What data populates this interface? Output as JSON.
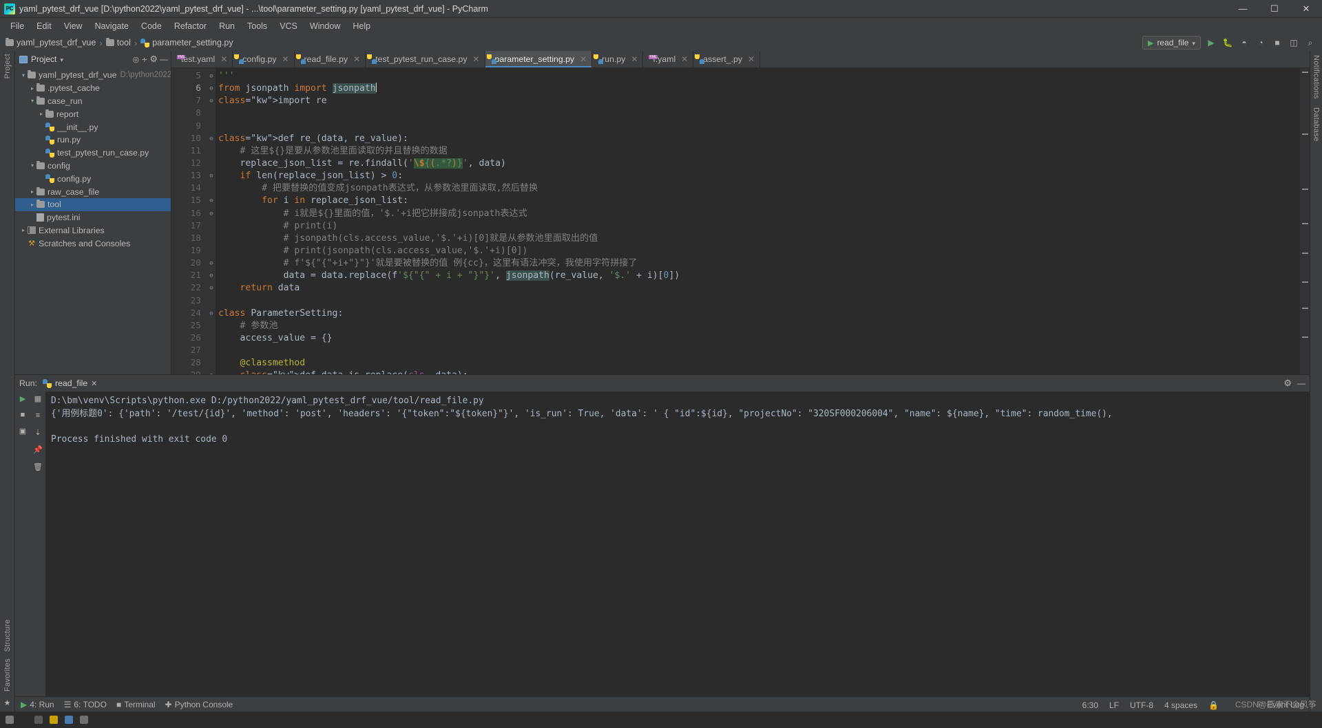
{
  "window": {
    "title": "yaml_pytest_drf_vue [D:\\python2022\\yaml_pytest_drf_vue] - ...\\tool\\parameter_setting.py [yaml_pytest_drf_vue] - PyCharm",
    "logo_text": "PC",
    "minimize": "—",
    "maximize": "☐",
    "close": "✕"
  },
  "menubar": {
    "items": [
      "File",
      "Edit",
      "View",
      "Navigate",
      "Code",
      "Refactor",
      "Run",
      "Tools",
      "VCS",
      "Window",
      "Help"
    ]
  },
  "breadcrumb": {
    "items": [
      {
        "label": "yaml_pytest_drf_vue",
        "icon": "folder-icon"
      },
      {
        "label": "tool",
        "icon": "folder-icon"
      },
      {
        "label": "parameter_setting.py",
        "icon": "python-file-icon"
      }
    ]
  },
  "navbar_right": {
    "run_config": "read_file",
    "run_config_chevron": "▾",
    "run_button": "▶",
    "debug_button": "🐞",
    "coverage_button": "◴",
    "profile_button": "◔",
    "stop_button": "■",
    "search_button": "⌕"
  },
  "left_stripe": {
    "labels": [
      "Project"
    ],
    "bottom_labels": [
      "Favorites"
    ],
    "structure_label": "Structure"
  },
  "right_stripe": {
    "labels": [
      "Notifications",
      "Database"
    ]
  },
  "project_panel": {
    "title": "Project",
    "title_chevron": "▾",
    "actions": [
      "target-icon",
      "collapse-all-icon",
      "settings-icon",
      "hide-icon"
    ],
    "tree": [
      {
        "depth": 0,
        "arrow": "▾",
        "icon": "folder-icon",
        "label": "yaml_pytest_drf_vue",
        "path": "D:\\python2022\\",
        "selected": false
      },
      {
        "depth": 1,
        "arrow": "▸",
        "icon": "folder-icon",
        "label": ".pytest_cache",
        "path": "",
        "selected": false
      },
      {
        "depth": 1,
        "arrow": "▾",
        "icon": "folder-icon",
        "label": "case_run",
        "path": "",
        "selected": false
      },
      {
        "depth": 2,
        "arrow": "▸",
        "icon": "folder-icon",
        "label": "report",
        "path": "",
        "selected": false
      },
      {
        "depth": 2,
        "arrow": "",
        "icon": "python-file-icon",
        "label": "__init__.py",
        "path": "",
        "selected": false
      },
      {
        "depth": 2,
        "arrow": "",
        "icon": "python-file-icon",
        "label": "run.py",
        "path": "",
        "selected": false
      },
      {
        "depth": 2,
        "arrow": "",
        "icon": "python-file-icon",
        "label": "test_pytest_run_case.py",
        "path": "",
        "selected": false
      },
      {
        "depth": 1,
        "arrow": "▾",
        "icon": "folder-icon",
        "label": "config",
        "path": "",
        "selected": false
      },
      {
        "depth": 2,
        "arrow": "",
        "icon": "python-file-icon",
        "label": "config.py",
        "path": "",
        "selected": false
      },
      {
        "depth": 1,
        "arrow": "▸",
        "icon": "folder-icon",
        "label": "raw_case_file",
        "path": "",
        "selected": false
      },
      {
        "depth": 1,
        "arrow": "▸",
        "icon": "folder-icon",
        "label": "tool",
        "path": "",
        "selected": true
      },
      {
        "depth": 1,
        "arrow": "",
        "icon": "ini-file-icon",
        "label": "pytest.ini",
        "path": "",
        "selected": false
      },
      {
        "depth": 0,
        "arrow": "▸",
        "icon": "library-icon",
        "label": "External Libraries",
        "path": "",
        "selected": false
      },
      {
        "depth": 0,
        "arrow": "",
        "icon": "scratches-icon",
        "label": "Scratches and Consoles",
        "path": "",
        "selected": false
      }
    ]
  },
  "editor_tabs": [
    {
      "label": "test.yaml",
      "icon": "yaml-file-icon",
      "active": false
    },
    {
      "label": "config.py",
      "icon": "python-file-icon",
      "active": false
    },
    {
      "label": "read_file.py",
      "icon": "python-file-icon",
      "active": false
    },
    {
      "label": "test_pytest_run_case.py",
      "icon": "python-file-icon",
      "active": false
    },
    {
      "label": "parameter_setting.py",
      "icon": "python-file-icon",
      "active": true
    },
    {
      "label": "run.py",
      "icon": "python-file-icon",
      "active": false
    },
    {
      "label": "f.yaml",
      "icon": "yaml-file-icon",
      "active": false
    },
    {
      "label": "assert_.py",
      "icon": "python-file-icon",
      "active": false
    }
  ],
  "editor": {
    "first_line": 5,
    "current_line": 6,
    "lines": [
      {
        "n": 5,
        "fold": "⊖",
        "text": "'''"
      },
      {
        "n": 6,
        "fold": "⊖",
        "text": "from jsonpath import jsonpath"
      },
      {
        "n": 7,
        "fold": "⊖",
        "text": "import re"
      },
      {
        "n": 8,
        "fold": "",
        "text": ""
      },
      {
        "n": 9,
        "fold": "",
        "text": ""
      },
      {
        "n": 10,
        "fold": "⊖",
        "text": "def re_(data, re_value):"
      },
      {
        "n": 11,
        "fold": "",
        "text": "    # 这里${}是要从参数池里面读取的并且替换的数据"
      },
      {
        "n": 12,
        "fold": "",
        "text": "    replace_json_list = re.findall('\\${(.*?)}', data)"
      },
      {
        "n": 13,
        "fold": "⊖",
        "text": "    if len(replace_json_list) > 0:"
      },
      {
        "n": 14,
        "fold": "",
        "text": "        # 把要替换的值变成jsonpath表达式，从参数池里面读取,然后替换"
      },
      {
        "n": 15,
        "fold": "⊖",
        "text": "        for i in replace_json_list:"
      },
      {
        "n": 16,
        "fold": "⊖",
        "text": "            # i就是${}里面的值，'$.'+i把它拼接成jsonpath表达式"
      },
      {
        "n": 17,
        "fold": "",
        "text": "            # print(i)"
      },
      {
        "n": 18,
        "fold": "",
        "text": "            # jsonpath(cls.access_value,'$.'+i)[0]就是从参数池里面取出的值"
      },
      {
        "n": 19,
        "fold": "",
        "text": "            # print(jsonpath(cls.access_value,'$.'+i)[0])"
      },
      {
        "n": 20,
        "fold": "⊖",
        "text": "            # f'${\"{\"+i+\"}\"}'就是要被替换的值 例{cc}，这里有语法冲突，我使用字符拼接了"
      },
      {
        "n": 21,
        "fold": "⊖",
        "text": "            data = data.replace(f'${\"{\" + i + \"}\"}', jsonpath(re_value, '$.' + i)[0])"
      },
      {
        "n": 22,
        "fold": "⊖",
        "text": "    return data"
      },
      {
        "n": 23,
        "fold": "",
        "text": ""
      },
      {
        "n": 24,
        "fold": "⊖",
        "text": "class ParameterSetting:"
      },
      {
        "n": 25,
        "fold": "",
        "text": "    # 参数池"
      },
      {
        "n": 26,
        "fold": "",
        "text": "    access_value = {}"
      },
      {
        "n": 27,
        "fold": "",
        "text": ""
      },
      {
        "n": 28,
        "fold": "",
        "text": "    @classmethod"
      },
      {
        "n": 29,
        "fold": "⊖",
        "text": "    def data_is_replace(cls, data):"
      }
    ]
  },
  "run_panel": {
    "label": "Run:",
    "tab_label": "read_file",
    "tab_icon": "python-file-icon",
    "tab_close": "✕",
    "settings_icon": "gear-icon",
    "hide_icon": "—",
    "side_buttons": [
      "run-icon",
      "stop-icon",
      "rerun-icon",
      "pin-icon",
      "trash-icon"
    ],
    "console": [
      "D:\\bm\\venv\\Scripts\\python.exe D:/python2022/yaml_pytest_drf_vue/tool/read_file.py",
      "{'用例标题0': {'path': '/test/{id}', 'method': 'post', 'headers': '{\"token\":\"${token}\"}', 'is_run': True, 'data': ' { \"id\":${id}, \"projectNo\": \"320SF000206004\", \"name\": ${name}, \"time\": random_time(),",
      "",
      "Process finished with exit code 0"
    ]
  },
  "statusbar": {
    "left_items": [
      {
        "label": "4: Run",
        "icon": "play-icon"
      },
      {
        "label": "6: TODO",
        "icon": "list-icon"
      },
      {
        "label": "Terminal",
        "icon": "terminal-icon"
      },
      {
        "label": "Python Console",
        "icon": "python-icon"
      }
    ],
    "right_items": [
      "6:30",
      "LF",
      "UTF-8",
      "4 spaces"
    ],
    "event_log": "Event Log",
    "lock_icon": "🔒",
    "chevron": "↕"
  },
  "watermark": "CSDN@亚索不会风筝",
  "colors": {
    "accent": "#4a88c7",
    "selection": "#2f5e8f",
    "editor_bg": "#2b2b2b",
    "chrome_bg": "#3c3f41",
    "keyword": "#cc7832",
    "string": "#6a8759",
    "comment": "#808080",
    "function": "#ffc66d",
    "number": "#6897bb",
    "decorator": "#bbb529"
  }
}
